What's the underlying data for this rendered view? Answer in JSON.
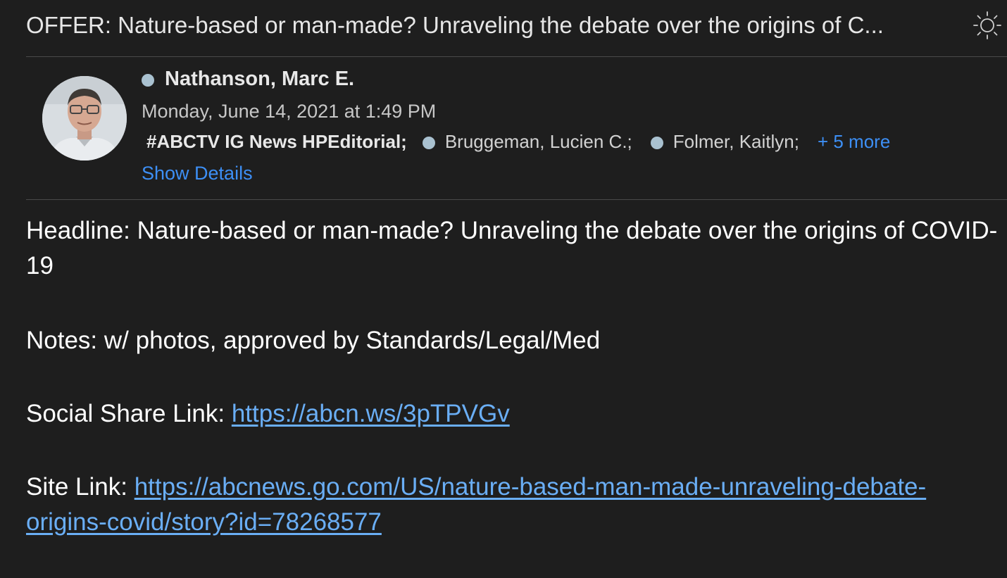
{
  "header": {
    "subject": "OFFER: Nature-based or man-made? Unraveling the debate over the origins of C..."
  },
  "sender": {
    "name": "Nathanson, Marc E.",
    "date": "Monday, June 14, 2021 at 1:49 PM"
  },
  "recipients": {
    "group": "#ABCTV IG News HPEditorial;",
    "people": [
      "Bruggeman, Lucien C.;",
      "Folmer, Kaitlyn;"
    ],
    "more": "+ 5 more",
    "show_details": "Show Details"
  },
  "body": {
    "headline": "Headline: Nature-based or man-made? Unraveling the debate over the origins of COVID-19",
    "notes": "Notes: w/ photos, approved by Standards/Legal/Med",
    "social_label": "Social Share Link: ",
    "social_url": "https://abcn.ws/3pTPVGv",
    "site_label": "Site Link: ",
    "site_url": "https://abcnews.go.com/US/nature-based-man-made-unraveling-debate-origins-covid/story?id=78268577"
  },
  "icons": {
    "theme": "sun-icon",
    "status": "presence-dot-icon"
  },
  "colors": {
    "background": "#1e1e1e",
    "link": "#6aaef5",
    "accent": "#3d8ff5",
    "presence": "#a9c1d0"
  }
}
